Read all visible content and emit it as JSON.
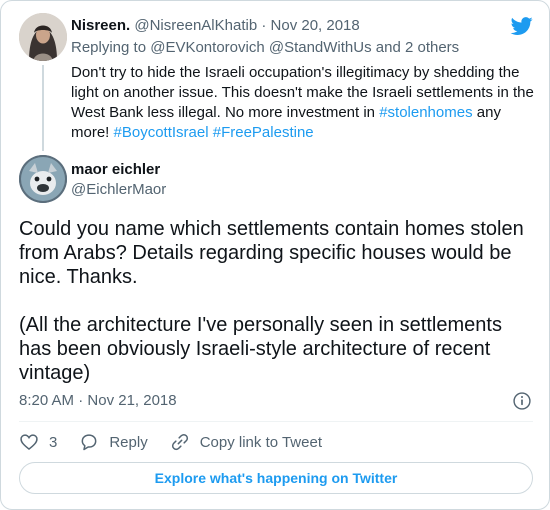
{
  "parent_tweet": {
    "author_name": "Nisreen.",
    "author_handle": "@NisreenAlKhatib",
    "separator": "·",
    "date": "Nov 20, 2018",
    "replying_prefix": "Replying to",
    "replying_to_1": "@EVKontorovich",
    "replying_to_2": "@StandWithUs",
    "replying_suffix": "and 2 others",
    "text_1": "Don't try to hide the Israeli occupation's illegitimacy by shedding the light on another issue. This doesn't make the Israeli settlements in the West Bank less illegal. No more investment in ",
    "hashtag_1": "#stolenhomes",
    "text_2": " any more! ",
    "hashtag_2": "#BoycottIsrael",
    "hashtag_3": "#FreePalestine"
  },
  "main_tweet": {
    "author_name": "maor eichler",
    "author_handle": "@EichlerMaor",
    "paragraph_1": "Could you name which settlements contain homes stolen from Arabs? Details regarding specific houses would be nice. Thanks.",
    "paragraph_2": "(All the architecture I've personally seen in settlements has been obviously Israeli-style architecture of recent vintage)",
    "time": "8:20 AM",
    "date": "Nov 21, 2018",
    "likes_count": "3",
    "reply_label": "Reply",
    "copy_link_label": "Copy link to Tweet"
  },
  "explore_button": "Explore what's happening on Twitter",
  "icons": {
    "brand": "twitter-bird-icon",
    "info": "info-icon",
    "like": "heart-icon",
    "reply": "reply-bubble-icon",
    "copy": "link-icon"
  },
  "colors": {
    "accent": "#1d9bf0",
    "muted": "#536471",
    "text": "#0f1419",
    "border": "#cfd9de"
  }
}
